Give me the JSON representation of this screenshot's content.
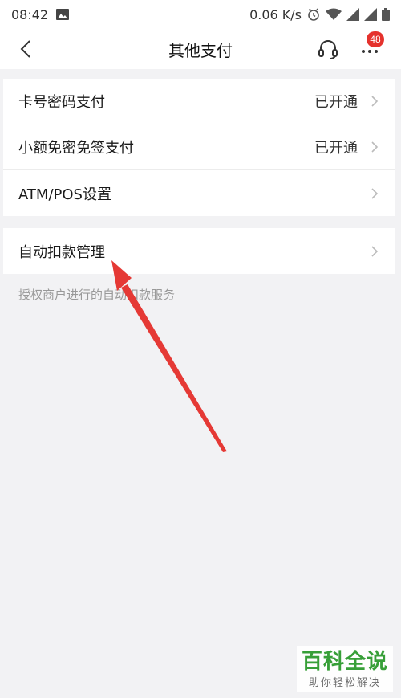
{
  "status_bar": {
    "time": "08:42",
    "speed": "0.06 K/s"
  },
  "nav": {
    "title": "其他支付",
    "badge_count": "48"
  },
  "groups": [
    {
      "items": [
        {
          "label": "卡号密码支付",
          "value": "已开通"
        },
        {
          "label": "小额免密免签支付",
          "value": "已开通"
        },
        {
          "label": "ATM/POS设置",
          "value": ""
        }
      ]
    },
    {
      "items": [
        {
          "label": "自动扣款管理",
          "value": ""
        }
      ]
    }
  ],
  "hint": "授权商户进行的自动扣款服务",
  "watermark": {
    "title": "百科全说",
    "subtitle": "助你轻松解决"
  },
  "colors": {
    "badge": "#e5322d",
    "arrow": "#e53935",
    "watermark_green": "#2e9b2e",
    "background": "#f2f2f4"
  }
}
